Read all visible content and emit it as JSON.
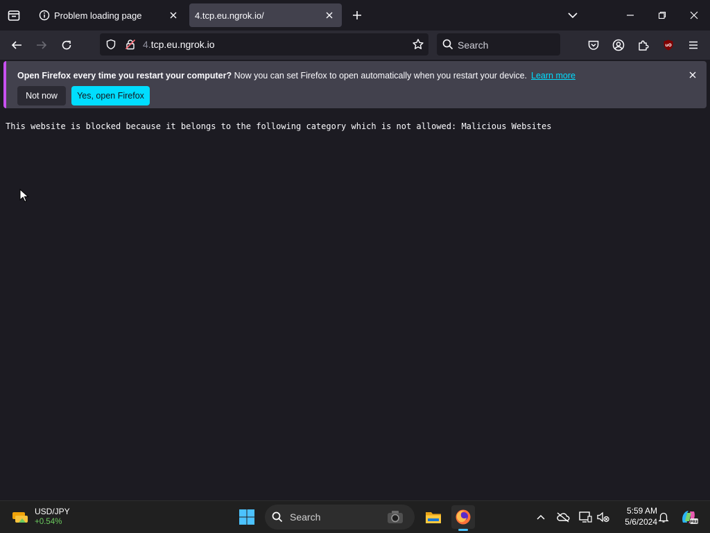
{
  "browser": {
    "tabs": [
      {
        "label": "Problem loading page",
        "active": false
      },
      {
        "label": "4.tcp.eu.ngrok.io/",
        "active": true
      }
    ],
    "url": {
      "prefix": "4.",
      "host": "tcp.eu.ngrok.io"
    },
    "search_placeholder": "Search",
    "accent_color": "#00ddff"
  },
  "notification": {
    "bold_text": "Open Firefox every time you restart your computer?",
    "text": " Now you can set Firefox to open automatically when you restart your device.",
    "learn_more": "Learn more",
    "not_now": "Not now",
    "yes_open": "Yes, open Firefox"
  },
  "page": {
    "message": "This website is blocked because it belongs to the following category which is not allowed: Malicious Websites"
  },
  "taskbar": {
    "widget": {
      "pair": "USD/JPY",
      "change": "+0.54%"
    },
    "search_placeholder": "Search",
    "clock": {
      "time": "5:59 AM",
      "date": "5/6/2024"
    }
  }
}
